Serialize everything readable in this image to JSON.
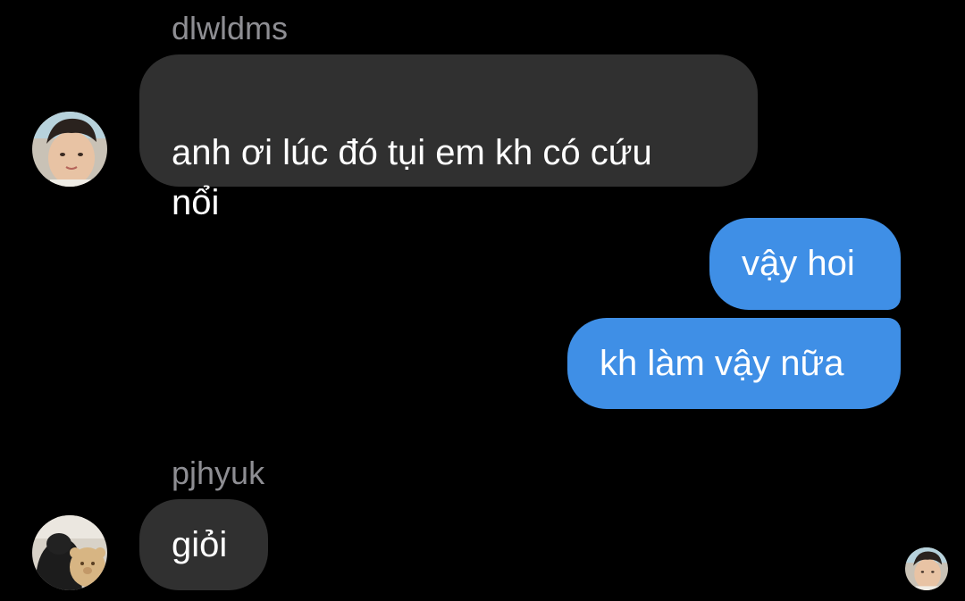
{
  "thread": {
    "messages": [
      {
        "direction": "incoming",
        "sender": "dlwldms",
        "text": "anh ơi lúc đó tụi em kh có cứu\nnổi"
      },
      {
        "direction": "outgoing",
        "text": "vậy hoi"
      },
      {
        "direction": "outgoing",
        "text": "kh làm vậy nữa"
      },
      {
        "direction": "incoming",
        "sender": "pjhyuk",
        "text": "giỏi"
      }
    ]
  },
  "colors": {
    "background": "#000000",
    "incoming_bubble": "#303030",
    "outgoing_bubble": "#3f8fe6",
    "sender_name": "#8e8e93",
    "text": "#ffffff"
  },
  "icons": {
    "avatar_dlwldms": "boy-face-avatar",
    "avatar_pjhyuk": "person-with-plush-avatar",
    "read_receipt": "boy-face-avatar-small"
  }
}
